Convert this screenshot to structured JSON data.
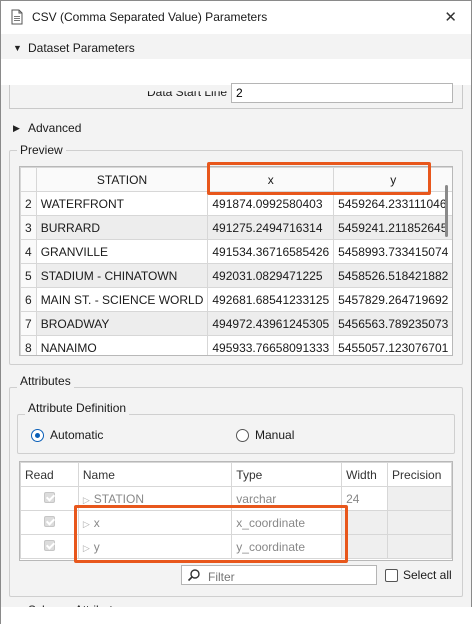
{
  "window": {
    "title": "CSV (Comma Separated Value) Parameters",
    "close_glyph": "✕"
  },
  "sections": {
    "dataset_parameters": "Dataset Parameters",
    "data_start_line_label": "Data Start Line",
    "data_start_line_value": "2",
    "advanced": "Advanced",
    "preview": "Preview",
    "attributes": "Attributes",
    "attribute_definition": "Attribute Definition",
    "schema_attributes": "Schema Attributes"
  },
  "preview": {
    "columns": [
      "STATION",
      "x",
      "y"
    ],
    "rows": [
      {
        "num": "2",
        "station": "WATERFRONT",
        "x": "491874.0992580403",
        "y": "5459264.233111046"
      },
      {
        "num": "3",
        "station": "BURRARD",
        "x": "491275.2494716314",
        "y": "5459241.211852645"
      },
      {
        "num": "4",
        "station": "GRANVILLE",
        "x": "491534.36716585426",
        "y": "5458993.733415074"
      },
      {
        "num": "5",
        "station": "STADIUM - CHINATOWN",
        "x": "492031.0829471225",
        "y": "5458526.518421882"
      },
      {
        "num": "6",
        "station": "MAIN ST. - SCIENCE WORLD",
        "x": "492681.68541233125",
        "y": "5457829.264719692"
      },
      {
        "num": "7",
        "station": "BROADWAY",
        "x": "494972.43961245305",
        "y": "5456563.789235073"
      },
      {
        "num": "8",
        "station": "NANAIMO",
        "x": "495933.76658091333",
        "y": "5455057.123076701"
      }
    ]
  },
  "attribute_definition": {
    "automatic_label": "Automatic",
    "manual_label": "Manual",
    "selected": "Automatic"
  },
  "attributes_table": {
    "columns": [
      "Read",
      "Name",
      "Type",
      "Width",
      "Precision"
    ],
    "rows": [
      {
        "name": "STATION",
        "type": "varchar",
        "width": "24",
        "precision": ""
      },
      {
        "name": "x",
        "type": "x_coordinate",
        "width": "",
        "precision": ""
      },
      {
        "name": "y",
        "type": "y_coordinate",
        "width": "",
        "precision": ""
      }
    ]
  },
  "filter": {
    "placeholder": "Filter",
    "select_all_label": "Select all"
  },
  "colors": {
    "highlight": "#e8571c",
    "radio_selected": "#0a5fb8"
  }
}
